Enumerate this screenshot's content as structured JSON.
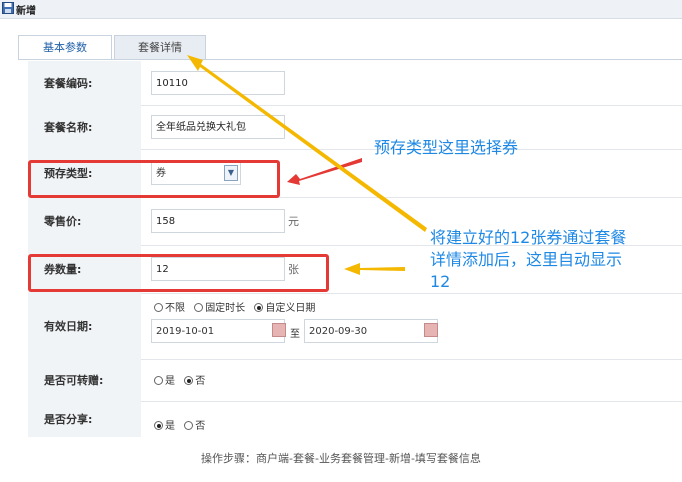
{
  "window": {
    "title": "新增"
  },
  "tabs": [
    {
      "label": "基本参数",
      "active": true
    },
    {
      "label": "套餐详情",
      "active": false
    }
  ],
  "form": {
    "code": {
      "label": "套餐编码:",
      "value": "10110"
    },
    "name": {
      "label": "套餐名称:",
      "value": "全年纸品兑换大礼包"
    },
    "prestore_type": {
      "label": "预存类型:",
      "value": "券"
    },
    "retail_price": {
      "label": "零售价:",
      "value": "158",
      "unit": "元"
    },
    "coupon_count": {
      "label": "券数量:",
      "value": "12",
      "unit": "张"
    },
    "validity": {
      "label": "有效日期:",
      "options": [
        {
          "label": "不限",
          "selected": false
        },
        {
          "label": "固定时长",
          "selected": false
        },
        {
          "label": "自定义日期",
          "selected": true
        }
      ],
      "start": "2019-10-01",
      "to": "至",
      "end": "2020-09-30"
    },
    "transferable": {
      "label": "是否可转赠:",
      "options": [
        {
          "label": "是",
          "selected": false
        },
        {
          "label": "否",
          "selected": true
        }
      ]
    },
    "shareable": {
      "label": "是否分享:",
      "options": [
        {
          "label": "是",
          "selected": true
        },
        {
          "label": "否",
          "selected": false
        }
      ]
    }
  },
  "annotations": {
    "type_note": "预存类型这里选择券",
    "count_note_line1": "将建立好的12张券通过套餐",
    "count_note_line2": "详情添加后，这里自动显示",
    "count_note_line3": "12"
  },
  "caption": "操作步骤：商户端-套餐-业务套餐管理-新增-填写套餐信息",
  "colors": {
    "highlight_red": "#e53935",
    "arrow_yellow": "#f5b800",
    "annotation_blue": "#1e88e5",
    "tab_active_text": "#2060a8"
  },
  "icons": {
    "window_icon": "save-icon",
    "dropdown": "chevron-down-icon",
    "calendar": "calendar-icon"
  }
}
